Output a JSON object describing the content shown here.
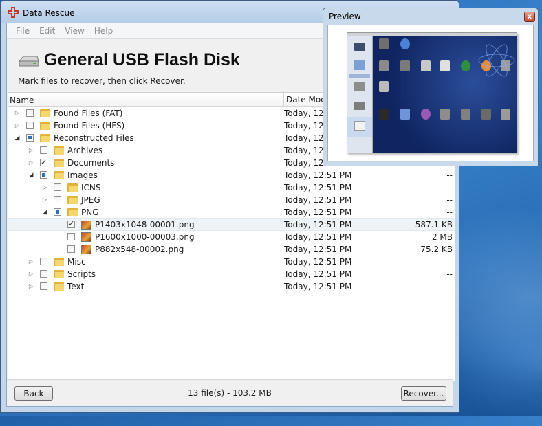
{
  "window": {
    "title": "Data Rescue"
  },
  "menu": [
    "File",
    "Edit",
    "View",
    "Help"
  ],
  "header": {
    "title": "General USB Flash Disk",
    "subtitle": "Mark files to recover, then click Recover."
  },
  "columns": {
    "name": "Name",
    "date": "Date Modified"
  },
  "rows": [
    {
      "label": "Found Files (FAT)",
      "date": "Today, 12:51 PM",
      "size": "--",
      "level": 0,
      "expander": "collapsed",
      "check": "unchecked",
      "icon": "folder"
    },
    {
      "label": "Found Files (HFS)",
      "date": "Today, 12:51 PM",
      "size": "--",
      "level": 0,
      "expander": "collapsed",
      "check": "unchecked",
      "icon": "folder"
    },
    {
      "label": "Reconstructed Files",
      "date": "Today, 12:51 PM",
      "size": "--",
      "level": 0,
      "expander": "expanded",
      "check": "partial",
      "icon": "folder"
    },
    {
      "label": "Archives",
      "date": "Today, 12:51 PM",
      "size": "--",
      "level": 1,
      "expander": "collapsed",
      "check": "unchecked",
      "icon": "folder"
    },
    {
      "label": "Documents",
      "date": "Today, 12:51 PM",
      "size": "--",
      "level": 1,
      "expander": "collapsed",
      "check": "checked",
      "icon": "folder"
    },
    {
      "label": "Images",
      "date": "Today, 12:51 PM",
      "size": "--",
      "level": 1,
      "expander": "expanded",
      "check": "partial",
      "icon": "folder"
    },
    {
      "label": "ICNS",
      "date": "Today, 12:51 PM",
      "size": "--",
      "level": 2,
      "expander": "collapsed",
      "check": "unchecked",
      "icon": "folder"
    },
    {
      "label": "JPEG",
      "date": "Today, 12:51 PM",
      "size": "--",
      "level": 2,
      "expander": "collapsed",
      "check": "unchecked",
      "icon": "folder"
    },
    {
      "label": "PNG",
      "date": "Today, 12:51 PM",
      "size": "--",
      "level": 2,
      "expander": "expanded",
      "check": "partial",
      "icon": "folder"
    },
    {
      "label": "P1403x1048-00001.png",
      "date": "Today, 12:51 PM",
      "size": "587.1 KB",
      "level": 3,
      "expander": "none",
      "check": "checked",
      "icon": "png",
      "selected": true
    },
    {
      "label": "P1600x1000-00003.png",
      "date": "Today, 12:51 PM",
      "size": "2 MB",
      "level": 3,
      "expander": "none",
      "check": "unchecked",
      "icon": "png"
    },
    {
      "label": "P882x548-00002.png",
      "date": "Today, 12:51 PM",
      "size": "75.2 KB",
      "level": 3,
      "expander": "none",
      "check": "unchecked",
      "icon": "png"
    },
    {
      "label": "Misc",
      "date": "Today, 12:51 PM",
      "size": "--",
      "level": 1,
      "expander": "collapsed",
      "check": "unchecked",
      "icon": "folder"
    },
    {
      "label": "Scripts",
      "date": "Today, 12:51 PM",
      "size": "--",
      "level": 1,
      "expander": "collapsed",
      "check": "unchecked",
      "icon": "folder"
    },
    {
      "label": "Text",
      "date": "Today, 12:51 PM",
      "size": "--",
      "level": 1,
      "expander": "collapsed",
      "check": "unchecked",
      "icon": "folder"
    }
  ],
  "footer": {
    "back_label": "Back",
    "status": "13 file(s) - 103.2 MB",
    "recover_label": "Recover..."
  },
  "preview": {
    "title": "Preview",
    "close_label": "x"
  },
  "colors": {
    "accent": "#2a6fb8",
    "folder": "#f6d66e",
    "close": "#c44a2f"
  }
}
